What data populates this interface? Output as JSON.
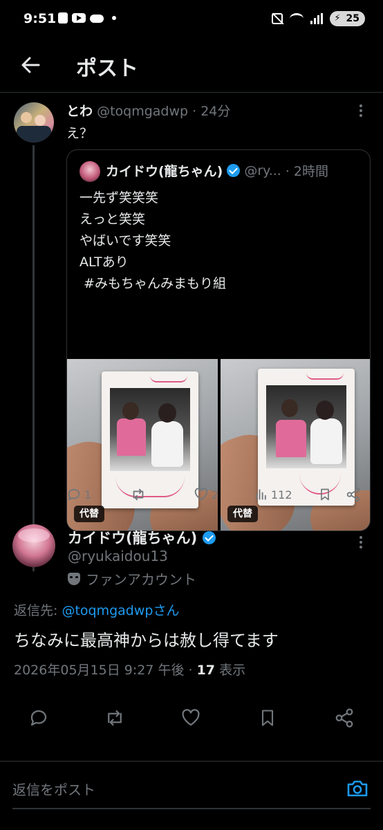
{
  "status_bar": {
    "time": "9:51",
    "battery": "25"
  },
  "header": {
    "title": "ポスト"
  },
  "parent_tweet": {
    "name": "とわ",
    "handle": "@toqmgadwp",
    "time": "· 24分",
    "text": "え？",
    "quote": {
      "name": "カイドウ(龍ちゃん)",
      "handle": "@ry...",
      "time": "· 2時間",
      "lines": [
        "一先ず笑笑笑",
        "えっと笑笑",
        "やばいです笑笑",
        "ALTあり",
        " #みもちゃんみまもり組"
      ],
      "alt_badges": [
        "代替",
        "代替"
      ]
    },
    "actions": {
      "replies": "1",
      "likes": "2",
      "views": "112"
    }
  },
  "main_tweet": {
    "name": "カイドウ(龍ちゃん)",
    "handle": "@ryukaidou13",
    "badge": "ファンアカウント",
    "reply_prefix": "返信先: ",
    "reply_to": "@toqmgadwpさん",
    "text": "ちなみに最高神からは赦し得てます",
    "timestamp": "2026年05月15日 9:27 午後 · ",
    "views_count": "17",
    "views_label": " 表示"
  },
  "reply_bar": {
    "placeholder": "返信をポスト"
  },
  "colors": {
    "background": "#000000",
    "text": "#e7e9ea",
    "muted": "#71767b",
    "accent": "#1d9bf0",
    "border": "#2f3336"
  }
}
